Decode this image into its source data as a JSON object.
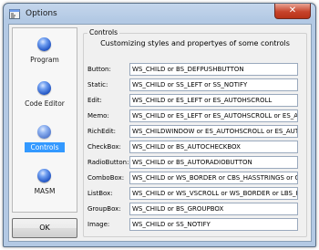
{
  "window": {
    "title": "Options",
    "close_glyph": "✕"
  },
  "sidebar": {
    "items": [
      {
        "label": "Program",
        "icon": "blue-orb-icon"
      },
      {
        "label": "Code Editor",
        "icon": "blue-orb-icon"
      },
      {
        "label": "Controls",
        "icon": "blue-orb-icon",
        "selected": true
      },
      {
        "label": "MASM",
        "icon": "blue-orb-icon"
      }
    ],
    "ok_label": "OK"
  },
  "controls": {
    "group_title": "Controls",
    "subtitle": "Customizing styles and propertyes of some controls",
    "rows": [
      {
        "label": "Button:",
        "value": "WS_CHILD or BS_DEFPUSHBUTTON"
      },
      {
        "label": "Static:",
        "value": "WS_CHILD or SS_LEFT or SS_NOTIFY"
      },
      {
        "label": "Edit:",
        "value": "WS_CHILD or ES_LEFT or ES_AUTOHSCROLL"
      },
      {
        "label": "Memo:",
        "value": "WS_CHILD or ES_LEFT or ES_AUTOHSCROLL or ES_AUTOV"
      },
      {
        "label": "RichEdit:",
        "value": "WS_CHILDWINDOW or ES_AUTOHSCROLL or ES_AUTOV"
      },
      {
        "label": "CheckBox:",
        "value": "WS_CHILD or BS_AUTOCHECKBOX"
      },
      {
        "label": "RadioButton:",
        "value": "WS_CHILD or BS_AUTORADIOBUTTON"
      },
      {
        "label": "ComboBox:",
        "value": "WS_CHILD or WS_BORDER or CBS_HASSTRINGS or CBS_D"
      },
      {
        "label": "ListBox:",
        "value": "WS_CHILD or WS_VSCROLL or WS_BORDER or LBS_HASST"
      },
      {
        "label": "GroupBox:",
        "value": "WS_CHILD or BS_GROUPBOX"
      },
      {
        "label": "Image:",
        "value": "WS_CHILD or SS_NOTIFY"
      }
    ]
  }
}
